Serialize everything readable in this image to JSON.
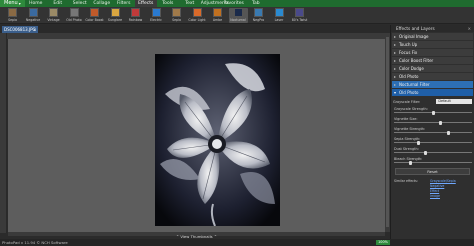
{
  "menubar": {
    "app_label": "Menu",
    "items": [
      "Home",
      "Edit",
      "Select",
      "Collage",
      "Filters",
      "Effects",
      "Tools",
      "Text",
      "Adjustments",
      "Favorites",
      "Tab"
    ],
    "active_index": 5
  },
  "toolbar": {
    "tools": [
      {
        "label": "Sepia",
        "color": "#8a6a44"
      },
      {
        "label": "Negative",
        "color": "#3a6aa0"
      },
      {
        "label": "Vintage",
        "color": "#9a8a66"
      },
      {
        "label": "Old Photo",
        "color": "#777777"
      },
      {
        "label": "Color Boost",
        "color": "#c05a2a"
      },
      {
        "label": "Sunglare",
        "color": "#d9a640"
      },
      {
        "label": "Rainbow",
        "color": "#c03a3a"
      },
      {
        "label": "Electric",
        "color": "#2a7ad0"
      },
      {
        "label": "Sepia",
        "color": "#a07a4a"
      },
      {
        "label": "Color Light",
        "color": "#d96a2a"
      },
      {
        "label": "Ambe",
        "color": "#c07020"
      },
      {
        "label": "Nocturnal",
        "color": "#1a2a4a"
      },
      {
        "label": "NegPro",
        "color": "#3a7ab0"
      },
      {
        "label": "Laser",
        "color": "#2a8ad0"
      },
      {
        "label": "80's Twist",
        "color": "#4a4a8a"
      }
    ],
    "selected_index": 11
  },
  "document": {
    "tab_title": "DSC006813.JPG",
    "close": "x"
  },
  "canvas": {
    "thumbnails_toggle": "⌃ View Thumbnails ⌃"
  },
  "statusbar": {
    "text": "PhotoPad v 11.94 © NCH Software",
    "zoom": "100%"
  },
  "panel": {
    "title": "Effects and Layers",
    "sections": [
      {
        "label": "Original Image",
        "state": "closed"
      },
      {
        "label": "Touch Up",
        "state": "closed"
      },
      {
        "label": "Focus Fix",
        "state": "closed"
      },
      {
        "label": "Color Boost Filter",
        "state": "closed"
      },
      {
        "label": "Color Dodge",
        "state": "closed"
      },
      {
        "label": "Old Photo",
        "state": "closed"
      },
      {
        "label": "Nocturnal Filter",
        "state": "closed"
      },
      {
        "label": "Old Photo",
        "state": "open"
      }
    ],
    "preset_label": "Grayscale Filter:",
    "preset_value": "Default",
    "sliders": [
      {
        "label": "Grayscale Strength:",
        "value": 50
      },
      {
        "label": "Vignette Size:",
        "value": 60
      },
      {
        "label": "Vignette Strength:",
        "value": 70
      },
      {
        "label": "Sepia Strength:",
        "value": 30
      },
      {
        "label": "Dust Strength:",
        "value": 40
      },
      {
        "label": "Bleach Strength:",
        "value": 20
      }
    ],
    "reset_label": "Reset",
    "similar_label": "Similar effects:",
    "links": [
      "Grayscale/Sepia",
      "Negative",
      "Effect",
      "Image"
    ]
  }
}
